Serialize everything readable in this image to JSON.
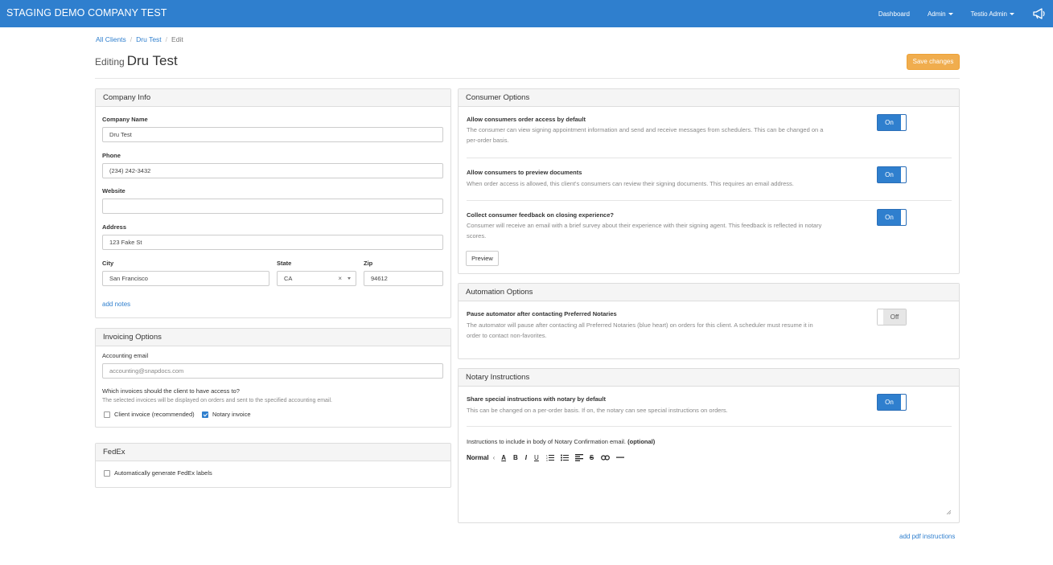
{
  "app": {
    "brand": "STAGING DEMO COMPANY TEST",
    "nav": {
      "dashboard": "Dashboard",
      "admin": "Admin",
      "user": "Testio Admin"
    }
  },
  "breadcrumb": {
    "all_clients": "All Clients",
    "client": "Dru Test",
    "current": "Edit"
  },
  "heading": {
    "prefix": "Editing",
    "name": "Dru Test",
    "save_label": "Save changes"
  },
  "company_info": {
    "title": "Company Info",
    "company_name_label": "Company Name",
    "company_name": "Dru Test",
    "phone_label": "Phone",
    "phone": "(234) 242-3432",
    "website_label": "Website",
    "website": "",
    "address_label": "Address",
    "address": "123 Fake St",
    "city_label": "City",
    "city": "San Francisco",
    "state_label": "State",
    "state": "CA",
    "zip_label": "Zip",
    "zip": "94612",
    "add_notes": "add notes"
  },
  "invoicing": {
    "title": "Invoicing Options",
    "accounting_email_label": "Accounting email",
    "accounting_email_placeholder": "accounting@snapdocs.com",
    "question": "Which invoices should the client to have access to?",
    "help": "The selected invoices will be displayed on orders and sent to the specified accounting email.",
    "client_invoice": "Client invoice (recommended)",
    "client_invoice_checked": false,
    "notary_invoice": "Notary invoice",
    "notary_invoice_checked": true
  },
  "fedex": {
    "title": "FedEx",
    "auto_labels": "Automatically generate FedEx labels",
    "auto_labels_checked": false
  },
  "consumer_options": {
    "title": "Consumer Options",
    "options": [
      {
        "title": "Allow consumers order access by default",
        "help1": "The consumer can view signing appointment information and send and receive messages from schedulers. This can be changed on a",
        "help2": "per-order basis.",
        "state": "On"
      },
      {
        "title": "Allow consumers to preview documents",
        "help1": "When order access is allowed, this client's consumers can review their signing documents. This requires an email address.",
        "state": "On"
      },
      {
        "title": "Collect consumer feedback on closing experience?",
        "help1": "Consumer will receive an email with a brief survey about their experience with their signing agent. This feedback is reflected in notary",
        "help2": "scores.",
        "state": "On"
      }
    ],
    "preview_label": "Preview"
  },
  "automation": {
    "title": "Automation Options",
    "option_title": "Pause automator after contacting Preferred Notaries",
    "help1": "The automator will pause after contacting all Preferred Notaries (blue heart) on orders for this client. A scheduler must resume it in",
    "help2": "order to contact non-favorites.",
    "state": "Off"
  },
  "notary": {
    "title": "Notary Instructions",
    "option_title": "Share special instructions with notary by default",
    "help": "This can be changed on a per-order basis. If on, the notary can see special instructions on orders.",
    "state": "On",
    "editor_label": "Instructions to include in body of Notary Confirmation email.",
    "editor_optional": "(optional)",
    "format_value": "Normal",
    "add_pdf": "add pdf instructions"
  },
  "colors": {
    "navbar": "#2f7fce",
    "save_button": "#f0ad4e",
    "toggle_on": "#2f7fce"
  }
}
